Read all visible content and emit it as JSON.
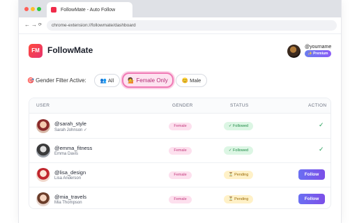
{
  "browser": {
    "tab_title": "FollowMate - Auto Follow",
    "url": "chrome-extension://followmate/dashboard",
    "nav": {
      "back": "←",
      "forward": "→",
      "reload": "⟳"
    }
  },
  "header": {
    "logo_text": "FM",
    "brand": "FollowMate",
    "username": "@yourname",
    "premium_label": "✨ Premium"
  },
  "filter": {
    "label": "🎯 Gender Filter Active:",
    "options": [
      {
        "label": "👥 All",
        "selected": false
      },
      {
        "label": "💁 Female Only",
        "selected": true
      },
      {
        "label": "😊 Male",
        "selected": false
      }
    ]
  },
  "table": {
    "headers": {
      "user": "USER",
      "gender": "GENDER",
      "status": "STATUS",
      "action": "ACTION"
    },
    "rows": [
      {
        "handle": "@sarah_style",
        "name": "Sarah Johnson ✓",
        "gender": "Female",
        "status": "✓ Followed",
        "action": "✓"
      },
      {
        "handle": "@emma_fitness",
        "name": "Emma Davis",
        "gender": "Female",
        "status": "✓ Followed",
        "action": "✓"
      },
      {
        "handle": "@lisa_design",
        "name": "Lisa Anderson",
        "gender": "Female",
        "status": "⏳ Pending",
        "action": "Follow"
      },
      {
        "handle": "@mia_travels",
        "name": "Mia Thompson",
        "gender": "Female",
        "status": "⏳ Pending",
        "action": "Follow"
      }
    ]
  },
  "colors": {
    "accent": "#7c4fe8",
    "brand": "#f02b4a",
    "female": "#c23a7d",
    "followed": "#1e8a45",
    "pending": "#9a6a06"
  }
}
